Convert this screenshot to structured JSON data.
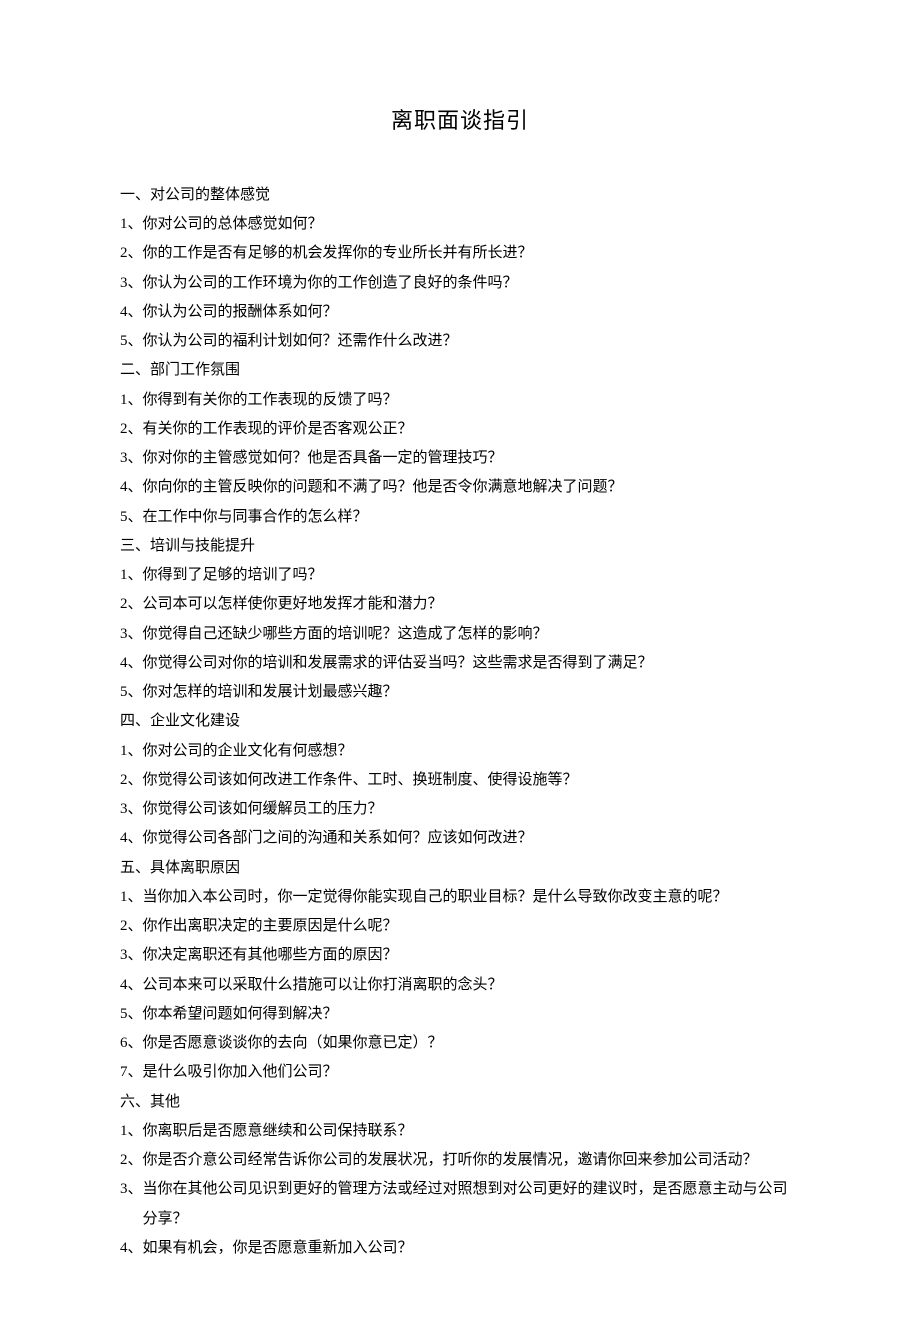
{
  "title": "离职面谈指引",
  "sections": [
    {
      "heading": "一、对公司的整体感觉",
      "items": [
        {
          "num": "1、",
          "text": "你对公司的总体感觉如何？"
        },
        {
          "num": "2、",
          "text": "你的工作是否有足够的机会发挥你的专业所长并有所长进？"
        },
        {
          "num": "3、",
          "text": "你认为公司的工作环境为你的工作创造了良好的条件吗？"
        },
        {
          "num": "4、",
          "text": "你认为公司的报酬体系如何？"
        },
        {
          "num": "5、",
          "text": "你认为公司的福利计划如何？还需作什么改进？"
        }
      ]
    },
    {
      "heading": "二、部门工作氛围",
      "items": [
        {
          "num": "1、",
          "text": "你得到有关你的工作表现的反馈了吗？"
        },
        {
          "num": "2、",
          "text": "有关你的工作表现的评价是否客观公正？"
        },
        {
          "num": "3、",
          "text": "你对你的主管感觉如何？他是否具备一定的管理技巧？"
        },
        {
          "num": "4、",
          "text": "你向你的主管反映你的问题和不满了吗？他是否令你满意地解决了问题？"
        },
        {
          "num": "5、",
          "text": "在工作中你与同事合作的怎么样？"
        }
      ]
    },
    {
      "heading": "三、培训与技能提升",
      "items": [
        {
          "num": "1、",
          "text": "你得到了足够的培训了吗？"
        },
        {
          "num": "2、",
          "text": "公司本可以怎样使你更好地发挥才能和潜力？"
        },
        {
          "num": "3、",
          "text": "你觉得自己还缺少哪些方面的培训呢？这造成了怎样的影响？"
        },
        {
          "num": "4、",
          "text": "你觉得公司对你的培训和发展需求的评估妥当吗？这些需求是否得到了满足？"
        },
        {
          "num": "5、",
          "text": "你对怎样的培训和发展计划最感兴趣？"
        }
      ]
    },
    {
      "heading": "四、企业文化建设",
      "items": [
        {
          "num": "1、",
          "text": "你对公司的企业文化有何感想？"
        },
        {
          "num": "2、",
          "text": "你觉得公司该如何改进工作条件、工时、换班制度、使得设施等？"
        },
        {
          "num": "3、",
          "text": "你觉得公司该如何缓解员工的压力？"
        },
        {
          "num": "4、",
          "text": "你觉得公司各部门之间的沟通和关系如何？应该如何改进？"
        }
      ]
    },
    {
      "heading": "五、具体离职原因",
      "items": [
        {
          "num": "1、",
          "text": "当你加入本公司时，你一定觉得你能实现自己的职业目标？是什么导致你改变主意的呢？"
        },
        {
          "num": "2、",
          "text": "你作出离职决定的主要原因是什么呢？"
        },
        {
          "num": "3、",
          "text": "你决定离职还有其他哪些方面的原因？"
        },
        {
          "num": "4、",
          "text": "公司本来可以采取什么措施可以让你打消离职的念头？"
        },
        {
          "num": "5、",
          "text": "你本希望问题如何得到解决？"
        },
        {
          "num": "6、",
          "text": "你是否愿意谈谈你的去向（如果你意已定）？"
        },
        {
          "num": "7、",
          "text": "是什么吸引你加入他们公司？"
        }
      ]
    },
    {
      "heading": "六、其他",
      "items": [
        {
          "num": "1、",
          "text": "你离职后是否愿意继续和公司保持联系？"
        },
        {
          "num": "2、",
          "text": "你是否介意公司经常告诉你公司的发展状况，打听你的发展情况，邀请你回来参加公司活动？"
        },
        {
          "num": "3、",
          "text": "当你在其他公司见识到更好的管理方法或经过对照想到对公司更好的建议时，是否愿意主动与公司分享？"
        },
        {
          "num": "4、",
          "text": "如果有机会，你是否愿意重新加入公司？"
        }
      ]
    }
  ]
}
